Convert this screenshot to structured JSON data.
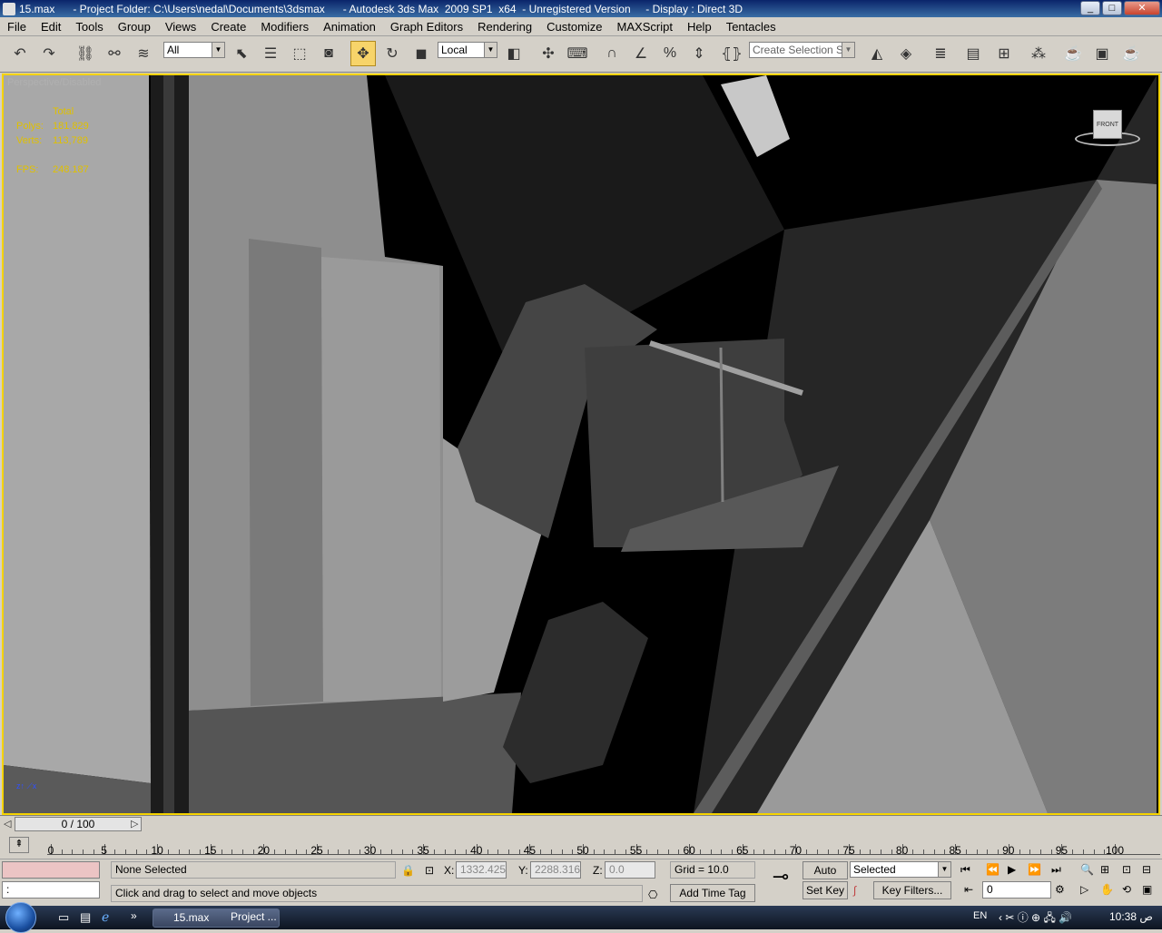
{
  "window": {
    "title": "15.max      - Project Folder: C:\\Users\\nedal\\Documents\\3dsmax      - Autodesk 3ds Max  2009 SP1  x64  - Unregistered Version     - Display : Direct 3D",
    "minimize": "_",
    "maximize": "□",
    "close": "✕"
  },
  "menu": [
    "File",
    "Edit",
    "Tools",
    "Group",
    "Views",
    "Create",
    "Modifiers",
    "Animation",
    "Graph Editors",
    "Rendering",
    "Customize",
    "MAXScript",
    "Help",
    "Tentacles"
  ],
  "toolbar": {
    "selection_filter": "All",
    "ref_coord": "Local",
    "named_selection_placeholder": "Create Selection Set",
    "icons": [
      "undo-icon",
      "redo-icon",
      "select-link-icon",
      "unlink-icon",
      "bind-space-warp-icon",
      "select-object-icon",
      "select-by-name-icon",
      "rectangular-region-icon",
      "window-crossing-icon",
      "select-move-icon",
      "select-rotate-icon",
      "select-scale-icon",
      "pivot-center-icon",
      "select-manipulate-icon",
      "keyboard-shortcut-icon",
      "snaps-toggle-icon",
      "angle-snap-icon",
      "percent-snap-icon",
      "spinner-snap-icon",
      "edit-named-selection-icon",
      "mirror-icon",
      "align-icon",
      "layer-manager-icon",
      "curve-editor-icon",
      "schematic-view-icon",
      "material-editor-icon",
      "render-setup-icon",
      "rendered-frame-window-icon",
      "render-production-icon"
    ]
  },
  "viewport": {
    "label": "Perspective/Disabled",
    "stats": {
      "header": "Total",
      "polys_label": "Polys:",
      "polys_value": "181,829",
      "verts_label": "Verts:",
      "verts_value": "113,789",
      "fps_label": "FPS:",
      "fps_value": "248.187"
    },
    "viewcube_label": "FRONT"
  },
  "timeline": {
    "slider": "0 / 100",
    "ticks": [
      "0",
      "5",
      "10",
      "15",
      "20",
      "25",
      "30",
      "35",
      "40",
      "45",
      "50",
      "55",
      "60",
      "65",
      "70",
      "75",
      "80",
      "85",
      "90",
      "95",
      "100"
    ]
  },
  "status": {
    "selection": "None Selected",
    "prompt": "Click and drag to select and move objects",
    "x_label": "X:",
    "x_value": "1332.425",
    "y_label": "Y:",
    "y_value": "2288.316",
    "z_label": "Z:",
    "z_value": "0.0",
    "grid": "Grid = 10.0",
    "add_time_tag": "Add Time Tag",
    "auto_key": "Auto Key",
    "set_key": "Set Key",
    "key_mode": "Selected",
    "key_filters": "Key Filters...",
    "frame": "0",
    "listener": ":"
  },
  "taskbar": {
    "task1": "15.max",
    "task2": "Project ...",
    "lang": "EN",
    "time": "10:38 ص"
  },
  "colors": {
    "viewport_border": "#f5d300",
    "stats_text": "#e0c000",
    "active_tool": "#f7d46a"
  }
}
